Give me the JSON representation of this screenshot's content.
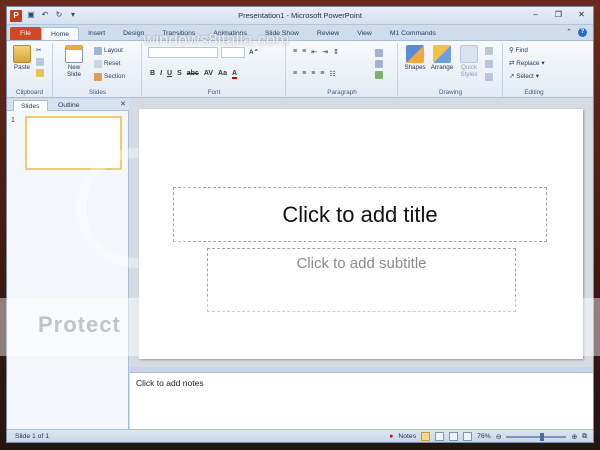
{
  "window": {
    "title": "Presentation1  -  Microsoft PowerPoint",
    "app_icon_letter": "P"
  },
  "ribbon_tabs": [
    {
      "label": "File"
    },
    {
      "label": "Home"
    },
    {
      "label": "Insert"
    },
    {
      "label": "Design"
    },
    {
      "label": "Transitions"
    },
    {
      "label": "Animations"
    },
    {
      "label": "Slide Show"
    },
    {
      "label": "Review"
    },
    {
      "label": "View"
    },
    {
      "label": "M1 Commands"
    }
  ],
  "ribbon": {
    "clipboard": {
      "label": "Clipboard",
      "paste": "Paste"
    },
    "slides": {
      "label": "Slides",
      "new_slide": "New Slide",
      "layout": "Layout",
      "reset": "Reset",
      "section": "Section"
    },
    "font": {
      "label": "Font"
    },
    "paragraph": {
      "label": "Paragraph"
    },
    "drawing": {
      "label": "Drawing",
      "shapes": "Shapes",
      "arrange": "Arrange",
      "quick_styles": "Quick Styles"
    },
    "editing": {
      "label": "Editing",
      "find": "Find",
      "replace": "Replace",
      "select": "Select"
    }
  },
  "pane": {
    "tabs": [
      "Slides",
      "Outline"
    ],
    "slide_number": "1"
  },
  "slide": {
    "title_placeholder": "Click to add title",
    "subtitle_placeholder": "Click to add subtitle"
  },
  "notes": {
    "placeholder": "Click to add notes"
  },
  "statusbar": {
    "slide_info": "Slide 1 of 1",
    "notes": "Notes",
    "zoom": "76%"
  },
  "watermark": {
    "site": "windows8italia.com",
    "protect": "Protect"
  },
  "colors": {
    "file_tab": "#d24726",
    "accent": "#2b6cc4",
    "selection": "#f5c96b"
  }
}
